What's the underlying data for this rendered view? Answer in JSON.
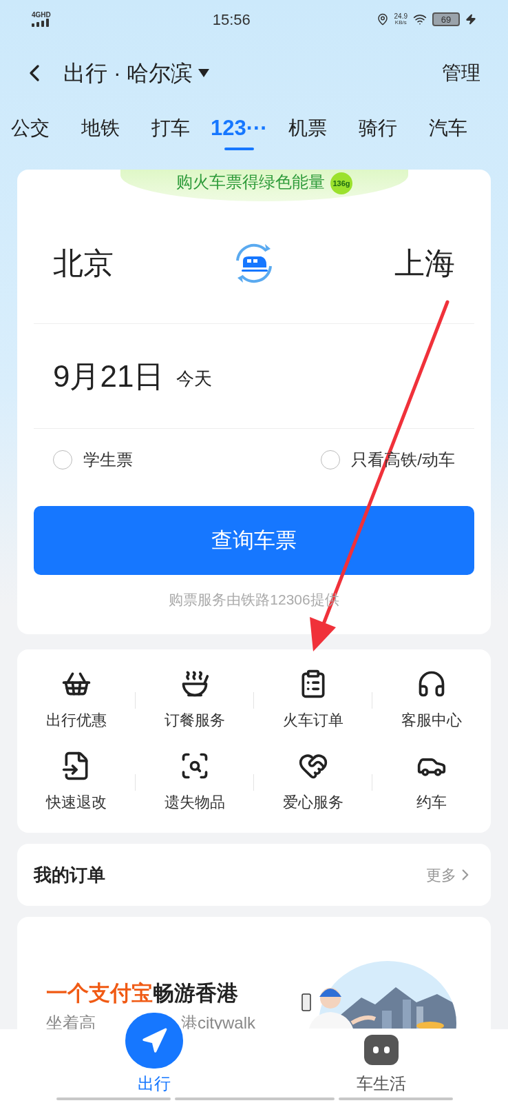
{
  "status_bar": {
    "network": "4GHD",
    "time": "15:56",
    "speed_value": "24.9",
    "speed_unit": "KB/s",
    "battery": "69",
    "charging": true
  },
  "header": {
    "back": true,
    "title": "出行 · 哈尔滨",
    "action": "管理"
  },
  "tabs": [
    {
      "label": "公交",
      "selected": false
    },
    {
      "label": "地铁",
      "selected": false
    },
    {
      "label": "打车",
      "selected": false
    },
    {
      "label": "123···",
      "selected": true
    },
    {
      "label": "机票",
      "selected": false
    },
    {
      "label": "骑行",
      "selected": false
    },
    {
      "label": "汽车",
      "selected": false
    }
  ],
  "ticket_card": {
    "banner": "购火车票得绿色能量",
    "banner_badge": "136g",
    "from": "北京",
    "to": "上海",
    "date": "9月21日",
    "date_note": "今天",
    "options": [
      {
        "label": "学生票",
        "checked": false
      },
      {
        "label": "只看高铁/动车",
        "checked": false
      }
    ],
    "search_button": "查询车票",
    "footer": "购票服务由铁路12306提供"
  },
  "services": [
    {
      "label": "出行优惠"
    },
    {
      "label": "订餐服务"
    },
    {
      "label": "火车订单"
    },
    {
      "label": "客服中心"
    },
    {
      "label": "快速退改"
    },
    {
      "label": "遗失物品"
    },
    {
      "label": "爱心服务"
    },
    {
      "label": "约车"
    }
  ],
  "orders": {
    "title": "我的订单",
    "more": "更多"
  },
  "promo": {
    "title_highlight": "一个支付宝",
    "title_rest": "畅游香港",
    "subtitle_start": "坐着高",
    "subtitle_end": "港citywalk"
  },
  "bottom_nav": [
    {
      "label": "出行",
      "selected": true
    },
    {
      "label": "车生活",
      "selected": false
    }
  ]
}
